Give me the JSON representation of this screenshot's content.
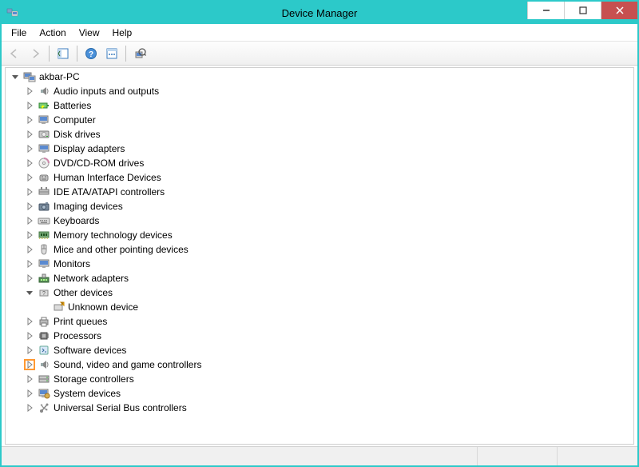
{
  "title": "Device Manager",
  "menu": {
    "file": "File",
    "action": "Action",
    "view": "View",
    "help": "Help"
  },
  "toolbar": {
    "back": "Back",
    "forward": "Forward",
    "show_hide": "Show/Hide Console Tree",
    "help": "Help",
    "action_menu": "Action menu",
    "scan": "Scan for hardware changes"
  },
  "tree": {
    "root": {
      "label": "akbar-PC",
      "expanded": true
    },
    "items": [
      {
        "label": "Audio inputs and outputs",
        "icon": "speaker"
      },
      {
        "label": "Batteries",
        "icon": "battery"
      },
      {
        "label": "Computer",
        "icon": "computer"
      },
      {
        "label": "Disk drives",
        "icon": "disk"
      },
      {
        "label": "Display adapters",
        "icon": "display"
      },
      {
        "label": "DVD/CD-ROM drives",
        "icon": "dvd"
      },
      {
        "label": "Human Interface Devices",
        "icon": "hid"
      },
      {
        "label": "IDE ATA/ATAPI controllers",
        "icon": "ide"
      },
      {
        "label": "Imaging devices",
        "icon": "imaging"
      },
      {
        "label": "Keyboards",
        "icon": "keyboard"
      },
      {
        "label": "Memory technology devices",
        "icon": "memory"
      },
      {
        "label": "Mice and other pointing devices",
        "icon": "mouse"
      },
      {
        "label": "Monitors",
        "icon": "monitor"
      },
      {
        "label": "Network adapters",
        "icon": "network"
      },
      {
        "label": "Other devices",
        "icon": "other",
        "expanded": true,
        "children": [
          {
            "label": "Unknown device",
            "icon": "unknown"
          }
        ]
      },
      {
        "label": "Print queues",
        "icon": "printer"
      },
      {
        "label": "Processors",
        "icon": "cpu"
      },
      {
        "label": "Software devices",
        "icon": "software"
      },
      {
        "label": "Sound, video and game controllers",
        "icon": "speaker",
        "highlight": true
      },
      {
        "label": "Storage controllers",
        "icon": "storage"
      },
      {
        "label": "System devices",
        "icon": "system"
      },
      {
        "label": "Universal Serial Bus controllers",
        "icon": "usb"
      }
    ]
  }
}
